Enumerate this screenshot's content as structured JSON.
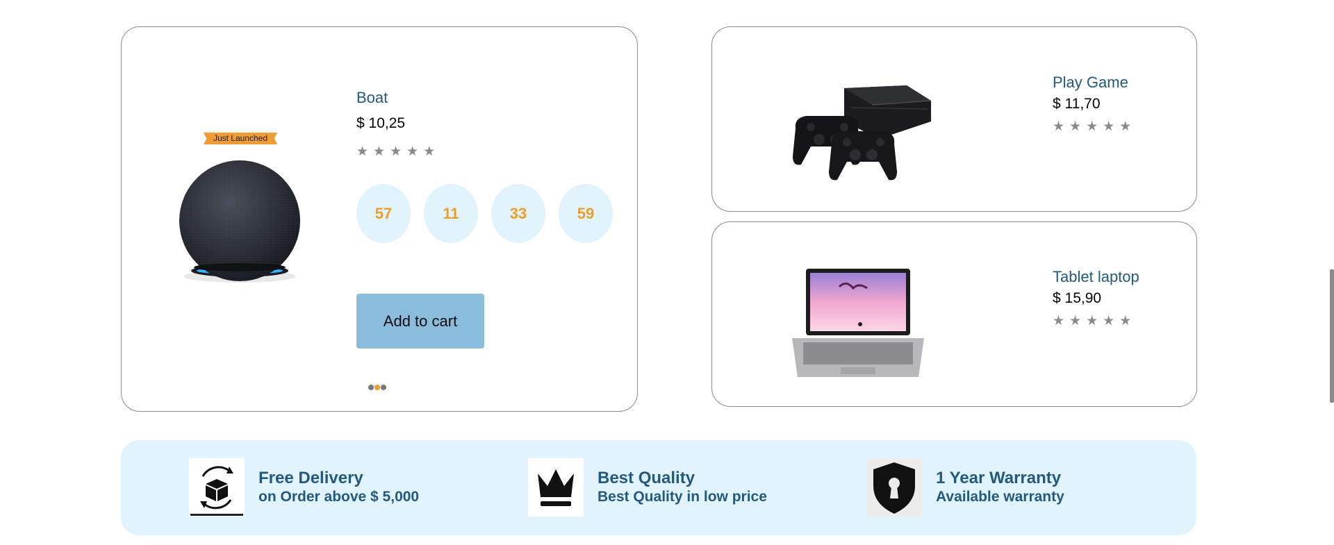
{
  "featured": {
    "badge": "Just Launched",
    "title": "Boat",
    "price": "$ 10,25",
    "rating": "5 stars",
    "countdown": [
      "57",
      "11",
      "33",
      "59"
    ],
    "cta": "Add to cart",
    "carousel": {
      "count": 3,
      "active": 2
    }
  },
  "products": [
    {
      "title": "Play Game",
      "price": "$ 11,70"
    },
    {
      "title": "Tablet laptop",
      "price": "$ 15,90"
    }
  ],
  "features": [
    {
      "title": "Free Delivery",
      "subtitle": "on Order above $ 5,000",
      "icon": "box-icon"
    },
    {
      "title": "Best Quality",
      "subtitle": "Best Quality in low price",
      "icon": "crown-icon"
    },
    {
      "title": "1 Year Warranty",
      "subtitle": "Available warranty",
      "icon": "shield-icon"
    }
  ],
  "colors": {
    "accent": "#24597f",
    "orange": "#ec9e28",
    "light_blue": "#e1f3fd",
    "button": "#8abcdc"
  }
}
